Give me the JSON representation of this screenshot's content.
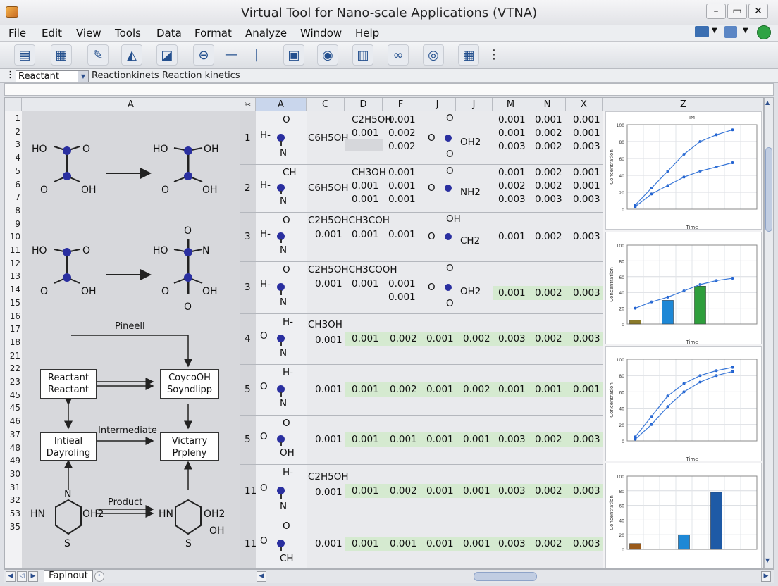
{
  "window": {
    "title": "Virtual Tool for Nano-scale Applications (VTNA)"
  },
  "menu": [
    "File",
    "Edit",
    "View",
    "Tools",
    "Data",
    "Format",
    "Analyze",
    "Window",
    "Help"
  ],
  "formula_bar": {
    "name_box": "Reactant",
    "sheet_name": "Reactionkinets",
    "label": "Reaction kinetics"
  },
  "columns": [
    "A",
    "C",
    "D",
    "F",
    "J",
    "J",
    "M",
    "N",
    "X",
    "Z"
  ],
  "row_numbers": [
    "1",
    "2",
    "3",
    "4",
    "5",
    "6",
    "7",
    "8",
    "9",
    "10",
    "11",
    "12",
    "13",
    "14",
    "15",
    "16",
    "17",
    "18",
    "21",
    "22",
    "23",
    "45",
    "45",
    "46",
    "37",
    "48",
    "49",
    "30",
    "31",
    "32",
    "53",
    "35"
  ],
  "diagram": {
    "m1_left": "HO",
    "m1_right": "O",
    "m1_bl": "O",
    "m1_br": "OH",
    "m2_left": "HO",
    "m2_right": "OH",
    "m2_bl": "O",
    "m2_br": "OH",
    "m3_left": "HO",
    "m3_right": "O",
    "m3_bl": "O",
    "m3_br": "OH",
    "m4_left": "HO",
    "m4_right": "N",
    "m4_top": "O",
    "m4_bl": "O",
    "m4_br": "OH",
    "m4_bottom": "O",
    "pinell": "Pineell",
    "box1": "Reactant\nReactant",
    "box2": "CoycoOH\nSoyndlipp",
    "box3": "Intieal\nDayroling",
    "box4": "Victarry\nPrpleny",
    "intermediate": "Intermediate",
    "product": "Product",
    "ring1_n": "N",
    "ring1_hn": "HN",
    "ring1_oh2": "OH2",
    "ring1_s": "S",
    "ring2_hn": "HN",
    "ring2_oh2": "OH2",
    "ring2_oh": "OH",
    "ring2_s": "S"
  },
  "table_rows": [
    {
      "id": "1",
      "mol": [
        "H-",
        "O",
        "N"
      ],
      "c": "C6H5OH",
      "d": [
        "C2H5OH",
        "0.001"
      ],
      "f": [
        "0.001",
        "0.002",
        "0.002"
      ],
      "jmol": [
        "O",
        "O",
        "OH2",
        "O"
      ],
      "m": [
        "0.001",
        "0.001",
        "0.003"
      ],
      "n": [
        "0.001",
        "0.002",
        "0.002"
      ],
      "x": [
        "0.001",
        "0.001",
        "0.003"
      ]
    },
    {
      "id": "2",
      "mol": [
        "H-",
        "CH",
        "N"
      ],
      "c": "C6H5OH",
      "d": [
        "CH3OH",
        "0.001",
        "0.001"
      ],
      "f": [
        "0.001",
        "0.001",
        "0.001"
      ],
      "jmol": [
        "O",
        "O",
        "NH2"
      ],
      "m": [
        "0.001",
        "0.002",
        "0.003"
      ],
      "n": [
        "0.002",
        "0.002",
        "0.003"
      ],
      "x": [
        "0.001",
        "0.001",
        "0.003"
      ]
    },
    {
      "id": "3",
      "mol": [
        "H-",
        "O",
        "N"
      ],
      "c": "C2H5OHCH3COH",
      "cv": "0.001",
      "d": [
        "0.001"
      ],
      "f": [
        "0.001"
      ],
      "jmol": [
        "OH",
        "O",
        "CH2"
      ],
      "m": [
        "0.001"
      ],
      "n": [
        "0.002"
      ],
      "x": [
        "0.003"
      ]
    },
    {
      "id": "3",
      "mol": [
        "H-",
        "O",
        "N"
      ],
      "c": "C2H5OHCH3COOH",
      "cv": "0.001",
      "d": [
        "0.001"
      ],
      "f": [
        "0.001",
        "0.001"
      ],
      "jmol": [
        "O",
        "O",
        "OH2",
        "O"
      ],
      "m": [
        "0.001"
      ],
      "n": [
        "0.002"
      ],
      "x": [
        "0.003"
      ]
    },
    {
      "id": "4",
      "mol": [
        "O",
        "H-",
        "N"
      ],
      "c": "CH3OH",
      "cv": "0.001",
      "vals": [
        "0.001",
        "0.002",
        "0.001",
        "0.002",
        "0.003",
        "0.002",
        "0.003"
      ]
    },
    {
      "id": "5",
      "mol": [
        "O",
        "H-",
        "N"
      ],
      "cv": "0.001",
      "vals": [
        "0.001",
        "0.002",
        "0.001",
        "0.002",
        "0.001",
        "0.001",
        "0.001"
      ]
    },
    {
      "id": "5",
      "mol": [
        "O",
        "O",
        "OH"
      ],
      "cv": "0.001",
      "vals": [
        "0.001",
        "0.001",
        "0.001",
        "0.001",
        "0.003",
        "0.002",
        "0.003"
      ]
    },
    {
      "id": "11",
      "mol": [
        "O",
        "H-",
        "N"
      ],
      "c": "C2H5OH",
      "cv": "0.001",
      "vals": [
        "0.001",
        "0.002",
        "0.001",
        "0.001",
        "0.003",
        "0.002",
        "0.003"
      ]
    },
    {
      "id": "11",
      "mol": [
        "O",
        "O",
        "CH"
      ],
      "cv": "0.001",
      "vals": [
        "0.001",
        "0.001",
        "0.001",
        "0.001",
        "0.003",
        "0.002",
        "0.003"
      ]
    }
  ],
  "status": {
    "sheet_tab": "Faplnout"
  },
  "chart_data": [
    {
      "type": "line",
      "title": "IM",
      "xlabel": "Time",
      "ylabel": "Concentration",
      "ylim": [
        0,
        100
      ],
      "x": [
        1,
        2,
        3,
        4,
        5,
        6,
        7,
        8
      ],
      "series": [
        {
          "values": [
            5,
            25,
            45,
            65,
            80,
            88,
            94
          ]
        },
        {
          "values": [
            3,
            18,
            28,
            38,
            45,
            50,
            55
          ]
        }
      ],
      "ytick_labels": [
        "100",
        "80",
        "60",
        "40",
        "20",
        "0"
      ]
    },
    {
      "type": "bar",
      "title": "",
      "xlabel": "Time",
      "ylabel": "Concentration",
      "ylim": [
        0,
        100
      ],
      "bars": [
        {
          "x": 1,
          "value": 5,
          "color": "#8a7a2a"
        },
        {
          "x": 3,
          "value": 30,
          "color": "#1e88d6"
        },
        {
          "x": 5,
          "value": 48,
          "color": "#2e9e3c"
        }
      ],
      "line": [
        20,
        28,
        34,
        42,
        50,
        55,
        58
      ],
      "ytick_labels": [
        "100",
        "80",
        "60",
        "40",
        "20",
        "0"
      ]
    },
    {
      "type": "line",
      "title": "",
      "xlabel": "Time",
      "ylabel": "Concentration",
      "ylim": [
        0,
        100
      ],
      "series": [
        {
          "values": [
            5,
            30,
            55,
            70,
            80,
            86,
            90
          ]
        },
        {
          "values": [
            2,
            20,
            42,
            60,
            72,
            80,
            85
          ]
        }
      ],
      "ytick_labels": [
        "100",
        "80",
        "60",
        "40",
        "20",
        "0"
      ]
    },
    {
      "type": "bar",
      "title": "",
      "xlabel": "",
      "ylabel": "Concentration",
      "ylim": [
        0,
        100
      ],
      "bars": [
        {
          "x": 1,
          "value": 8,
          "color": "#9a5a1a"
        },
        {
          "x": 4,
          "value": 20,
          "color": "#1e88d6"
        },
        {
          "x": 6,
          "value": 78,
          "color": "#1e5aa6"
        }
      ],
      "ytick_labels": [
        "100",
        "80",
        "60",
        "40",
        "20",
        "0"
      ]
    }
  ],
  "chart_labels": {
    "time1": "Time",
    "time2": "Time",
    "time3": "Time",
    "ylab": "Concentration",
    "title1": "IM"
  }
}
